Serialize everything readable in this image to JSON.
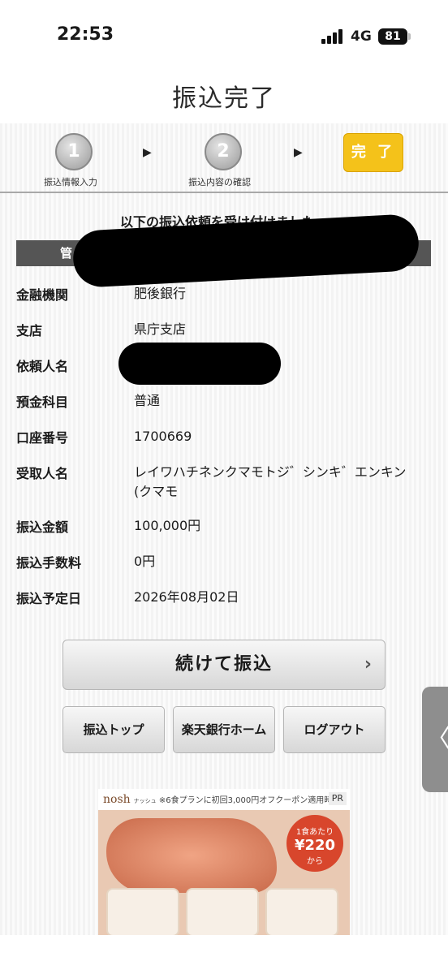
{
  "status_bar": {
    "time": "22:53",
    "network": "4G",
    "battery": "81"
  },
  "page_title": "振込完了",
  "steps": [
    {
      "number": "1",
      "label": "振込情報入力"
    },
    {
      "number": "2",
      "label": "振込内容の確認"
    },
    {
      "label": "完 了"
    }
  ],
  "message": "以下の振込依頼を受け付けました。",
  "dark_bar_label": "管",
  "details": [
    {
      "key": "金融機関",
      "value": "肥後銀行"
    },
    {
      "key": "支店",
      "value": "県庁支店"
    },
    {
      "key": "依頼人名",
      "value": ""
    },
    {
      "key": "預金科目",
      "value": "普通"
    },
    {
      "key": "口座番号",
      "value": "1700669"
    },
    {
      "key": "受取人名",
      "value": "レイワハチネンクマモトジ゛シンキ゛エンキン (クマモ"
    },
    {
      "key": "振込金額",
      "value": "100,000円"
    },
    {
      "key": "振込手数料",
      "value": "0円"
    },
    {
      "key": "振込予定日",
      "value": "2026年08月02日"
    }
  ],
  "buttons": {
    "continue": "続けて振込",
    "transfer_top": "振込トップ",
    "bank_home": "楽天銀行ホーム",
    "logout": "ログアウト"
  },
  "ad": {
    "brand": "nosh",
    "brand_ruby": "ナッシュ",
    "headline": "※6食プランに初回3,000円オフクーポン適用時",
    "pr": "PR",
    "badge_top": "1食あたり",
    "badge_price": "¥220",
    "badge_bottom": "から"
  },
  "side_tab_glyph": "〈"
}
